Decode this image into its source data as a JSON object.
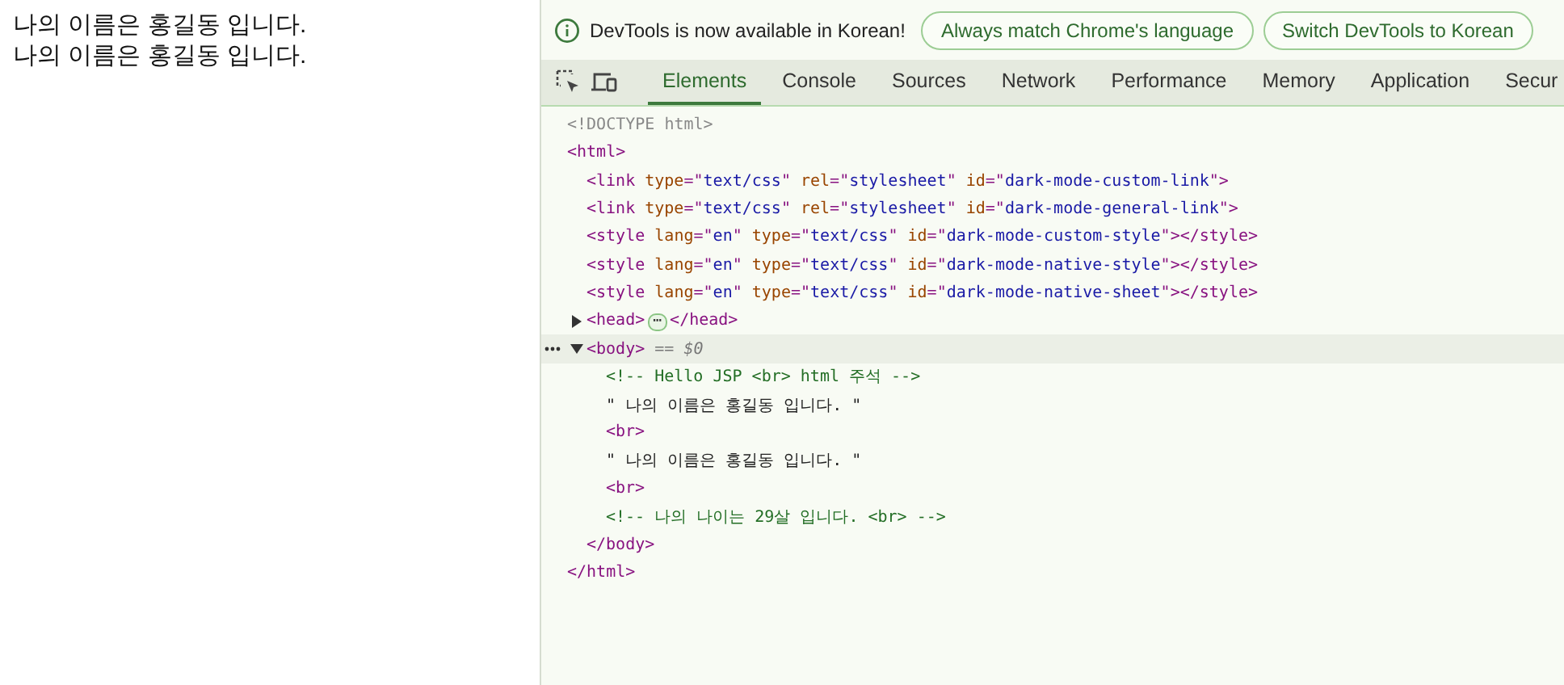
{
  "page": {
    "lines": [
      "나의 이름은 홍길동 입니다.",
      "나의 이름은 홍길동 입니다."
    ]
  },
  "infobar": {
    "message": "DevTools is now available in Korean!",
    "buttons": [
      "Always match Chrome's language",
      "Switch DevTools to Korean"
    ]
  },
  "tabs": [
    {
      "label": "Elements",
      "selected": true
    },
    {
      "label": "Console",
      "selected": false
    },
    {
      "label": "Sources",
      "selected": false
    },
    {
      "label": "Network",
      "selected": false
    },
    {
      "label": "Performance",
      "selected": false
    },
    {
      "label": "Memory",
      "selected": false
    },
    {
      "label": "Application",
      "selected": false
    },
    {
      "label": "Secur",
      "selected": false
    }
  ],
  "dom": [
    {
      "selected": false,
      "tokens": [
        {
          "kind": "doctype",
          "text": "<!DOCTYPE html>"
        }
      ]
    },
    {
      "selected": false,
      "tokens": [
        {
          "kind": "tag",
          "text": "<html>"
        }
      ],
      "close": [
        {
          "kind": "tag",
          "text": "</html>"
        }
      ],
      "children": [
        {
          "selected": false,
          "tokens": [
            {
              "kind": "tag",
              "text": "<link "
            },
            {
              "kind": "attr",
              "text": "type"
            },
            {
              "kind": "tag",
              "text": "=\""
            },
            {
              "kind": "value",
              "text": "text/css"
            },
            {
              "kind": "tag",
              "text": "\" "
            },
            {
              "kind": "attr",
              "text": "rel"
            },
            {
              "kind": "tag",
              "text": "=\""
            },
            {
              "kind": "value",
              "text": "stylesheet"
            },
            {
              "kind": "tag",
              "text": "\" "
            },
            {
              "kind": "attr",
              "text": "id"
            },
            {
              "kind": "tag",
              "text": "=\""
            },
            {
              "kind": "value",
              "text": "dark-mode-custom-link"
            },
            {
              "kind": "tag",
              "text": "\">"
            }
          ]
        },
        {
          "selected": false,
          "tokens": [
            {
              "kind": "tag",
              "text": "<link "
            },
            {
              "kind": "attr",
              "text": "type"
            },
            {
              "kind": "tag",
              "text": "=\""
            },
            {
              "kind": "value",
              "text": "text/css"
            },
            {
              "kind": "tag",
              "text": "\" "
            },
            {
              "kind": "attr",
              "text": "rel"
            },
            {
              "kind": "tag",
              "text": "=\""
            },
            {
              "kind": "value",
              "text": "stylesheet"
            },
            {
              "kind": "tag",
              "text": "\" "
            },
            {
              "kind": "attr",
              "text": "id"
            },
            {
              "kind": "tag",
              "text": "=\""
            },
            {
              "kind": "value",
              "text": "dark-mode-general-link"
            },
            {
              "kind": "tag",
              "text": "\">"
            }
          ]
        },
        {
          "selected": false,
          "tokens": [
            {
              "kind": "tag",
              "text": "<style "
            },
            {
              "kind": "attr",
              "text": "lang"
            },
            {
              "kind": "tag",
              "text": "=\""
            },
            {
              "kind": "value",
              "text": "en"
            },
            {
              "kind": "tag",
              "text": "\" "
            },
            {
              "kind": "attr",
              "text": "type"
            },
            {
              "kind": "tag",
              "text": "=\""
            },
            {
              "kind": "value",
              "text": "text/css"
            },
            {
              "kind": "tag",
              "text": "\" "
            },
            {
              "kind": "attr",
              "text": "id"
            },
            {
              "kind": "tag",
              "text": "=\""
            },
            {
              "kind": "value",
              "text": "dark-mode-custom-style"
            },
            {
              "kind": "tag",
              "text": "\"></style>"
            }
          ]
        },
        {
          "selected": false,
          "tokens": [
            {
              "kind": "tag",
              "text": "<style "
            },
            {
              "kind": "attr",
              "text": "lang"
            },
            {
              "kind": "tag",
              "text": "=\""
            },
            {
              "kind": "value",
              "text": "en"
            },
            {
              "kind": "tag",
              "text": "\" "
            },
            {
              "kind": "attr",
              "text": "type"
            },
            {
              "kind": "tag",
              "text": "=\""
            },
            {
              "kind": "value",
              "text": "text/css"
            },
            {
              "kind": "tag",
              "text": "\" "
            },
            {
              "kind": "attr",
              "text": "id"
            },
            {
              "kind": "tag",
              "text": "=\""
            },
            {
              "kind": "value",
              "text": "dark-mode-native-style"
            },
            {
              "kind": "tag",
              "text": "\"></style>"
            }
          ]
        },
        {
          "selected": false,
          "tokens": [
            {
              "kind": "tag",
              "text": "<style "
            },
            {
              "kind": "attr",
              "text": "lang"
            },
            {
              "kind": "tag",
              "text": "=\""
            },
            {
              "kind": "value",
              "text": "en"
            },
            {
              "kind": "tag",
              "text": "\" "
            },
            {
              "kind": "attr",
              "text": "type"
            },
            {
              "kind": "tag",
              "text": "=\""
            },
            {
              "kind": "value",
              "text": "text/css"
            },
            {
              "kind": "tag",
              "text": "\" "
            },
            {
              "kind": "attr",
              "text": "id"
            },
            {
              "kind": "tag",
              "text": "=\""
            },
            {
              "kind": "value",
              "text": "dark-mode-native-sheet"
            },
            {
              "kind": "tag",
              "text": "\"></style>"
            }
          ]
        },
        {
          "selected": false,
          "expanded": false,
          "tokens": [
            {
              "kind": "tag",
              "text": "<head>"
            },
            {
              "kind": "badge",
              "text": "⋯"
            },
            {
              "kind": "tag",
              "text": "</head>"
            }
          ]
        },
        {
          "selected": true,
          "expanded": true,
          "tokens": [
            {
              "kind": "tag",
              "text": "<body>"
            },
            {
              "kind": "marker",
              "text": " == $0"
            }
          ],
          "close": [
            {
              "kind": "tag",
              "text": "</body>"
            }
          ],
          "children": [
            {
              "selected": false,
              "tokens": [
                {
                  "kind": "comment",
                  "text": "<!-- Hello JSP <br> html 주석 -->"
                }
              ]
            },
            {
              "selected": false,
              "tokens": [
                {
                  "kind": "text",
                  "text": "\" 나의 이름은 홍길동 입니다. \""
                }
              ]
            },
            {
              "selected": false,
              "tokens": [
                {
                  "kind": "tag",
                  "text": "<br>"
                }
              ]
            },
            {
              "selected": false,
              "tokens": [
                {
                  "kind": "text",
                  "text": "\" 나의 이름은 홍길동 입니다. \""
                }
              ]
            },
            {
              "selected": false,
              "tokens": [
                {
                  "kind": "tag",
                  "text": "<br>"
                }
              ]
            },
            {
              "selected": false,
              "tokens": [
                {
                  "kind": "comment",
                  "text": "<!-- 나의 나이는 29살 입니다. <br> -->"
                }
              ]
            }
          ]
        }
      ]
    }
  ]
}
